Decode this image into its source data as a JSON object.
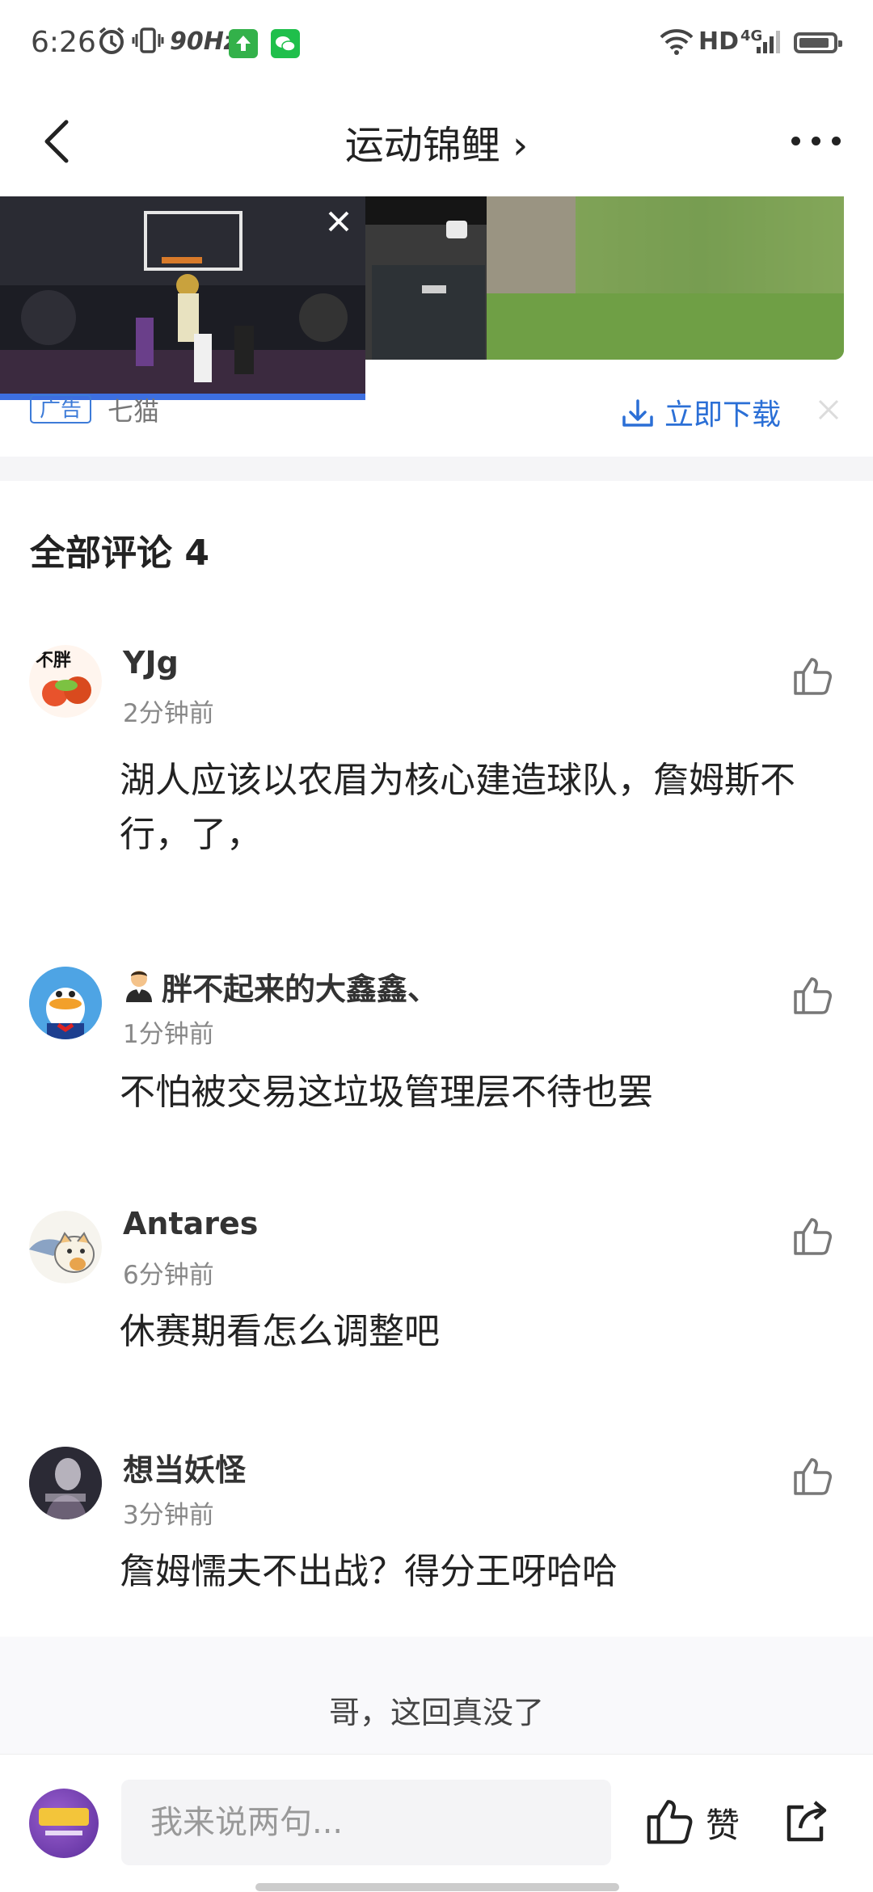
{
  "status_bar": {
    "time": "6:26",
    "refresh_rate": "90Hz",
    "network_label": "HD",
    "network_type": "4G"
  },
  "header": {
    "title": "运动锦鲤 ›"
  },
  "ad": {
    "tag": "广告",
    "source": "七猫",
    "download_label": "立即下载"
  },
  "comments_section": {
    "title": "全部评论 4",
    "comments": [
      {
        "user": "YJg",
        "time": "2分钟前",
        "text": "湖人应该以农眉为核心建造球队，詹姆斯不行，了，",
        "avatar_text": "不胖"
      },
      {
        "user": "胖不起来的大鑫鑫、",
        "time": "1分钟前",
        "text": "不怕被交易这垃圾管理层不待也罢"
      },
      {
        "user": "Antares",
        "time": "6分钟前",
        "text": "休赛期看怎么调整吧"
      },
      {
        "user": "想当妖怪",
        "time": "3分钟前",
        "text": "詹姆懦夫不出战？得分王呀哈哈"
      }
    ],
    "end_text": "哥，这回真没了"
  },
  "bottom_bar": {
    "input_placeholder": "我来说两句...",
    "like_label": "赞"
  },
  "colors": {
    "accent_blue": "#2b6fd6",
    "band_bg": "#f5f5f7"
  }
}
